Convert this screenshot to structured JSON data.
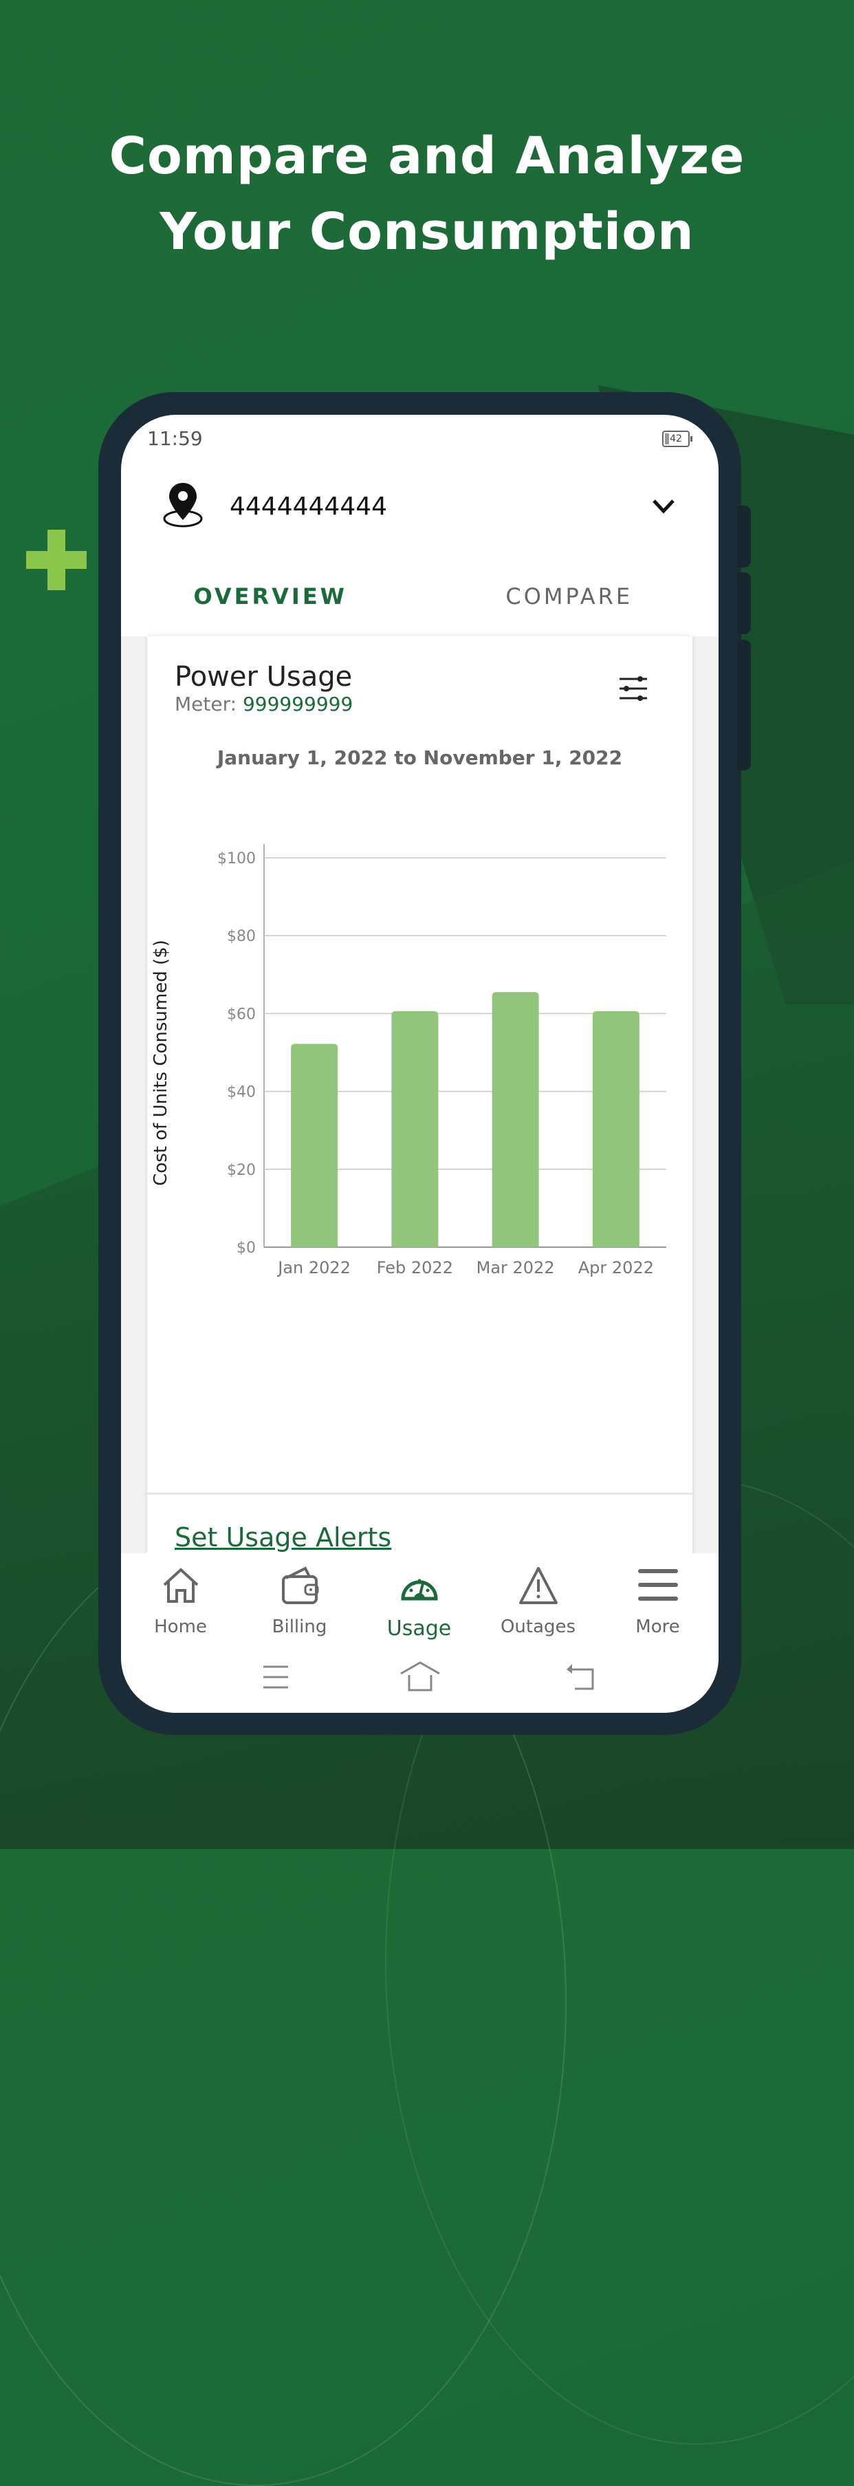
{
  "headline": {
    "line1": "Compare and Analyze",
    "line2": "Your Consumption"
  },
  "colors": {
    "brand_green": "#1a6a3a",
    "bar_green": "#93c47d",
    "accent_plus": "#8cc54c",
    "phone_frame": "#1c2b38"
  },
  "status_bar": {
    "time": "11:59",
    "battery": "42"
  },
  "account": {
    "icon": "location-pin-icon",
    "number": "4444444444",
    "dropdown_icon": "chevron-down-icon"
  },
  "tabs": [
    {
      "label": "OVERVIEW",
      "active": true
    },
    {
      "label": "COMPARE",
      "active": false
    }
  ],
  "card": {
    "title": "Power Usage",
    "meter_label": "Meter: ",
    "meter_value": "999999999",
    "filter_icon": "sliders-icon",
    "date_range": "January 1, 2022 to November 1, 2022"
  },
  "chart_data": {
    "type": "bar",
    "title": "",
    "categories": [
      "Jan 2022",
      "Feb 2022",
      "Mar 2022",
      "Apr 2022"
    ],
    "values": [
      52.2,
      60.6,
      65.5,
      60.6
    ],
    "ylabel": "Cost of Units Consumed ($)",
    "xlabel": "",
    "ylim": [
      0,
      100
    ],
    "yticks": [
      0,
      20,
      40,
      60,
      80,
      100
    ],
    "ytick_labels": [
      "$0",
      "$20",
      "$40",
      "$60",
      "$80",
      "$100"
    ],
    "grid": true,
    "legend": "none"
  },
  "alerts_link": "Set Usage Alerts",
  "bottom_nav": [
    {
      "label": "Home",
      "icon": "home-icon",
      "active": false
    },
    {
      "label": "Billing",
      "icon": "wallet-icon",
      "active": false
    },
    {
      "label": "Usage",
      "icon": "gauge-icon",
      "active": true
    },
    {
      "label": "Outages",
      "icon": "warning-icon",
      "active": false
    },
    {
      "label": "More",
      "icon": "menu-icon",
      "active": false
    }
  ],
  "system_nav": [
    {
      "icon": "recent-apps-icon"
    },
    {
      "icon": "system-home-icon"
    },
    {
      "icon": "back-icon"
    }
  ]
}
